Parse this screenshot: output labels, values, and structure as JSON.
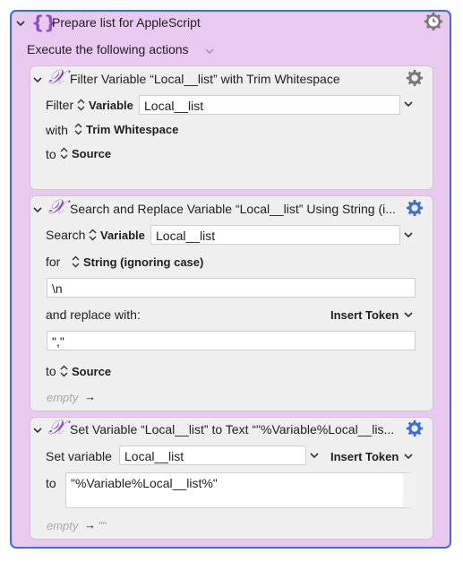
{
  "group": {
    "title": "Prepare list for AppleScript",
    "mode_label": "Execute the following actions"
  },
  "actions": [
    {
      "title": "Filter Variable “Local__list” with Trim Whitespace",
      "filter_label": "Filter",
      "filter_type": "Variable",
      "filter_value": "Local__list",
      "with_label": "with",
      "with_value": "Trim Whitespace",
      "to_label": "to",
      "to_value": "Source"
    },
    {
      "title": "Search and Replace Variable “Local__list” Using String (i...",
      "search_label": "Search",
      "search_type": "Variable",
      "search_value": "Local__list",
      "for_label": "for",
      "for_value": "String (ignoring case)",
      "search_text": "\\n",
      "replace_label": "and replace with:",
      "insert_token": "Insert Token",
      "replace_text": "\",\"",
      "to_label": "to",
      "to_value": "Source",
      "empty_label": "empty"
    },
    {
      "title": "Set Variable “Local__list” to Text “\"%Variable%Local__lis...",
      "set_label": "Set variable",
      "set_value": "Local__list",
      "insert_token": "Insert Token",
      "to_label": "to",
      "to_text": "\"%Variable%Local__list%\"",
      "empty_label": "empty",
      "empty_result": "\"\""
    }
  ],
  "colors": {
    "group_bg": "#e9c9f0",
    "group_border": "#3d6ed8",
    "brand_purple": "#8a4cc6",
    "action_bg": "#efefef"
  },
  "icons": [
    "chevron-down-icon",
    "curly-braces-icon",
    "gear-clock-icon",
    "gear-icon",
    "x-variable-icon",
    "updown-arrows-icon",
    "right-arrow-icon"
  ]
}
